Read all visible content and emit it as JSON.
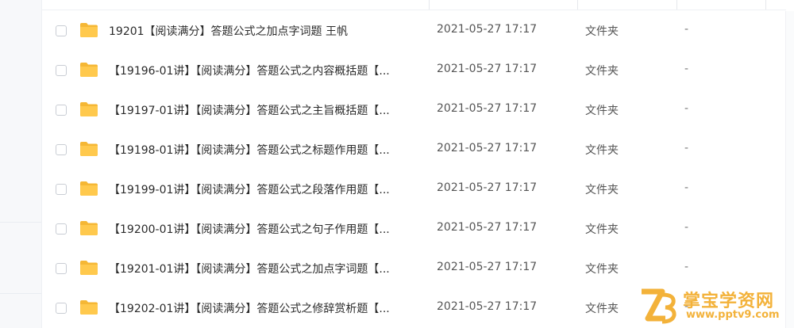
{
  "colors": {
    "folder": "#ffc94d",
    "folder_dark": "#f5b735",
    "watermark": "#f3b23a"
  },
  "files": [
    {
      "name": "19201【阅读满分】答题公式之加点字词题 王帆",
      "modified": "2021-05-27 17:17",
      "type": "文件夹",
      "size": "-"
    },
    {
      "name": "【19196-01讲】【阅读满分】答题公式之内容概括题【...",
      "modified": "2021-05-27 17:17",
      "type": "文件夹",
      "size": "-"
    },
    {
      "name": "【19197-01讲】【阅读满分】答题公式之主旨概括题【...",
      "modified": "2021-05-27 17:17",
      "type": "文件夹",
      "size": "-"
    },
    {
      "name": "【19198-01讲】【阅读满分】答题公式之标题作用题【...",
      "modified": "2021-05-27 17:17",
      "type": "文件夹",
      "size": "-"
    },
    {
      "name": "【19199-01讲】【阅读满分】答题公式之段落作用题【...",
      "modified": "2021-05-27 17:17",
      "type": "文件夹",
      "size": "-"
    },
    {
      "name": "【19200-01讲】【阅读满分】答题公式之句子作用题【...",
      "modified": "2021-05-27 17:17",
      "type": "文件夹",
      "size": "-"
    },
    {
      "name": "【19201-01讲】【阅读满分】答题公式之加点字词题【...",
      "modified": "2021-05-27 17:17",
      "type": "文件夹",
      "size": "-"
    },
    {
      "name": "【19202-01讲】【阅读满分】答题公式之修辞赏析题【...",
      "modified": "2021-05-27 17:17",
      "type": "文件夹",
      "size": "-"
    }
  ],
  "watermark": {
    "title": "掌宝学资网",
    "url": "www.pptv9.com"
  }
}
